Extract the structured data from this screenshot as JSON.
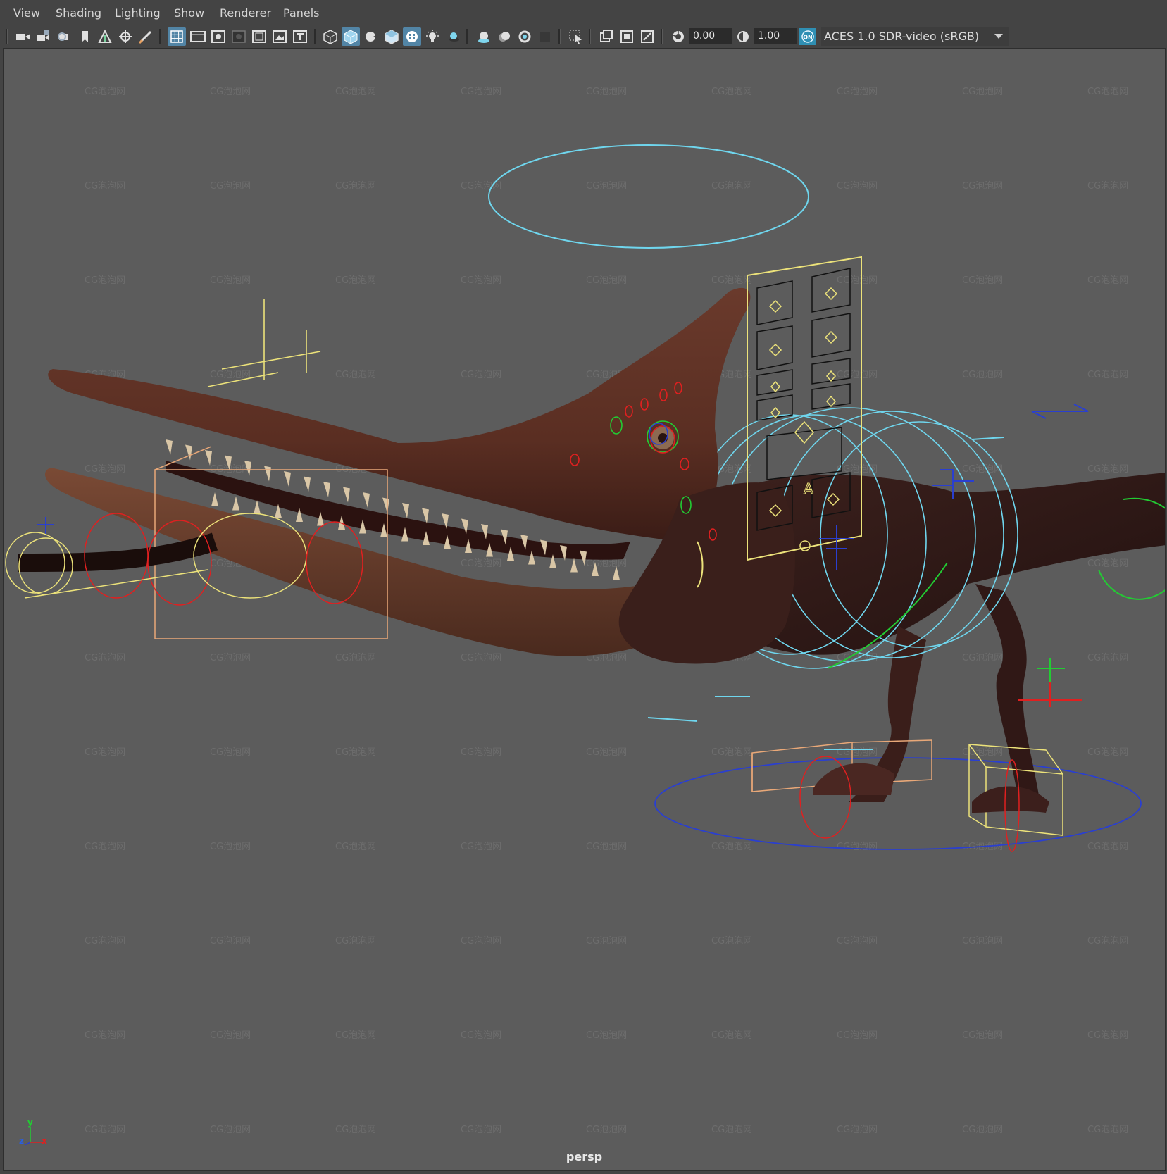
{
  "menu": {
    "view": "View",
    "shading": "Shading",
    "lighting": "Lighting",
    "show": "Show",
    "renderer": "Renderer",
    "panels": "Panels"
  },
  "toolbar": {
    "exposure_value": "0.00",
    "gamma_value": "1.00",
    "color_mgmt_badge": "ON",
    "color_space": "ACES 1.0 SDR-video (sRGB)",
    "icons": [
      "select-camera-icon",
      "camera-attributes-icon",
      "bookmarks-icon",
      "image-plane-icon",
      "two-d-pan-zoom-icon",
      "grease-pencil-icon",
      "grid-icon",
      "film-gate-icon",
      "resolution-gate-icon",
      "gate-mask-icon",
      "field-chart-icon",
      "safe-action-icon",
      "safe-title-icon",
      "wireframe-icon",
      "smooth-shade-icon",
      "wireframe-on-shaded-icon",
      "textured-icon",
      "use-all-lights-icon",
      "shadows-icon",
      "ambient-occlusion-icon",
      "motion-blur-icon",
      "anti-aliasing-icon",
      "depth-of-field-icon",
      "isolate-select-icon",
      "xray-icon",
      "xray-joints-icon",
      "xray-active-icon",
      "exposure-icon",
      "gamma-icon",
      "color-management-icon"
    ]
  },
  "viewport": {
    "camera": "persp",
    "watermark": "CG泡泡网",
    "axis": {
      "x": "x",
      "y": "y",
      "z": "z"
    },
    "colors": {
      "background": "#5c5c5c",
      "cyan_ctrl": "#6fd6ee",
      "yellow_ctrl": "#ece27a",
      "red_ctrl": "#e02020",
      "green_ctrl": "#22cc33",
      "blue_ctrl": "#2a3fd0",
      "orange_ctrl": "#e9a878",
      "skin_dark": "#3a1e1a",
      "beak": "#6e3528"
    }
  }
}
